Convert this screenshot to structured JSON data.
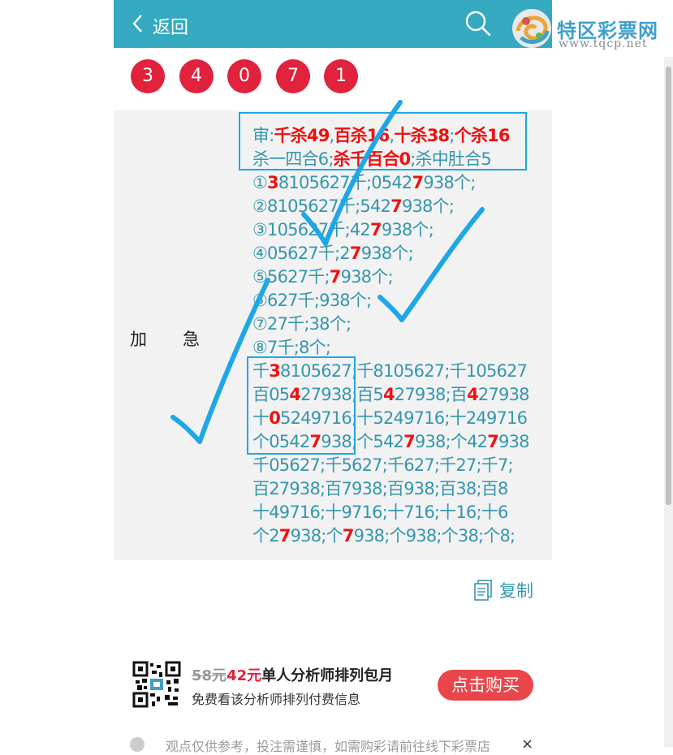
{
  "header": {
    "back_label": "返回",
    "logo_title": "特区彩票网",
    "logo_url": "www.tqcp.net"
  },
  "balls": [
    "3",
    "4",
    "0",
    "7",
    "1"
  ],
  "panel": {
    "side_label_1": "加",
    "side_label_2": "急",
    "lines": [
      [
        {
          "t": "审:",
          "c": 0
        },
        {
          "t": "千杀49",
          "c": 1
        },
        {
          "t": ",",
          "c": 0
        },
        {
          "t": "百杀16",
          "c": 1
        },
        {
          "t": ",",
          "c": 0
        },
        {
          "t": "十杀38",
          "c": 1
        },
        {
          "t": ";",
          "c": 0
        },
        {
          "t": "个杀16",
          "c": 1
        }
      ],
      [
        {
          "t": "杀一四合6;",
          "c": 0
        },
        {
          "t": "杀千百合0",
          "c": 1
        },
        {
          "t": ";杀中肚合5",
          "c": 0
        }
      ],
      [
        {
          "t": "①",
          "c": 0
        },
        {
          "t": "3",
          "c": 1
        },
        {
          "t": "8105627千;0542",
          "c": 0
        },
        {
          "t": "7",
          "c": 1
        },
        {
          "t": "938个;",
          "c": 0
        }
      ],
      [
        {
          "t": "②8105627千;542",
          "c": 0
        },
        {
          "t": "7",
          "c": 1
        },
        {
          "t": "938个;",
          "c": 0
        }
      ],
      [
        {
          "t": "③105627千;42",
          "c": 0
        },
        {
          "t": "7",
          "c": 1
        },
        {
          "t": "938个;",
          "c": 0
        }
      ],
      [
        {
          "t": "④05627千;2",
          "c": 0
        },
        {
          "t": "7",
          "c": 1
        },
        {
          "t": "938个;",
          "c": 0
        }
      ],
      [
        {
          "t": "⑤5627千;",
          "c": 0
        },
        {
          "t": "7",
          "c": 1
        },
        {
          "t": "938个;",
          "c": 0
        }
      ],
      [
        {
          "t": "⑥627千;938个;",
          "c": 0
        }
      ],
      [
        {
          "t": "⑦27千;38个;",
          "c": 0
        }
      ],
      [
        {
          "t": "⑧7千;8个;",
          "c": 0
        }
      ],
      [
        {
          "t": "千",
          "c": 0
        },
        {
          "t": "3",
          "c": 1
        },
        {
          "t": "8105627;千8105627;千105627",
          "c": 0
        }
      ],
      [
        {
          "t": "百05",
          "c": 0
        },
        {
          "t": "4",
          "c": 1
        },
        {
          "t": "27938;百5",
          "c": 0
        },
        {
          "t": "4",
          "c": 1
        },
        {
          "t": "27938;百",
          "c": 0
        },
        {
          "t": "4",
          "c": 1
        },
        {
          "t": "27938",
          "c": 0
        }
      ],
      [
        {
          "t": "十",
          "c": 0
        },
        {
          "t": "0",
          "c": 1
        },
        {
          "t": "5249716;十5249716;十249716",
          "c": 0
        }
      ],
      [
        {
          "t": "个0542",
          "c": 0
        },
        {
          "t": "7",
          "c": 1
        },
        {
          "t": "938;个542",
          "c": 0
        },
        {
          "t": "7",
          "c": 1
        },
        {
          "t": "938;个42",
          "c": 0
        },
        {
          "t": "7",
          "c": 1
        },
        {
          "t": "938",
          "c": 0
        }
      ],
      [
        {
          "t": "千05627;千5627;千627;千27;千7;",
          "c": 0
        }
      ],
      [
        {
          "t": "百27938;百7938;百938;百38;百8",
          "c": 0
        }
      ],
      [
        {
          "t": "十49716;十9716;十716;十16;十6",
          "c": 0
        }
      ],
      [
        {
          "t": "个2",
          "c": 0
        },
        {
          "t": "7",
          "c": 1
        },
        {
          "t": "938;个",
          "c": 0
        },
        {
          "t": "7",
          "c": 1
        },
        {
          "t": "938;个938;个38;个8;",
          "c": 0
        }
      ]
    ]
  },
  "copy_label": "复制",
  "promo": {
    "old_price": "58元",
    "new_price": "42元",
    "title": "单人分析师排列包月",
    "subtitle": "免费看该分析师排列付费信息",
    "buy_label": "点击购买"
  },
  "notice": {
    "text": "观点仅供参考，投注需谨慎，如需购彩请前往线下彩票店",
    "close": "×"
  },
  "colors": {
    "header_bg": "#35a9c0",
    "ball": "#e0223d",
    "text_teal": "#3596ad",
    "highlight_red": "#ee1111",
    "check_blue": "#1ea7e6"
  }
}
